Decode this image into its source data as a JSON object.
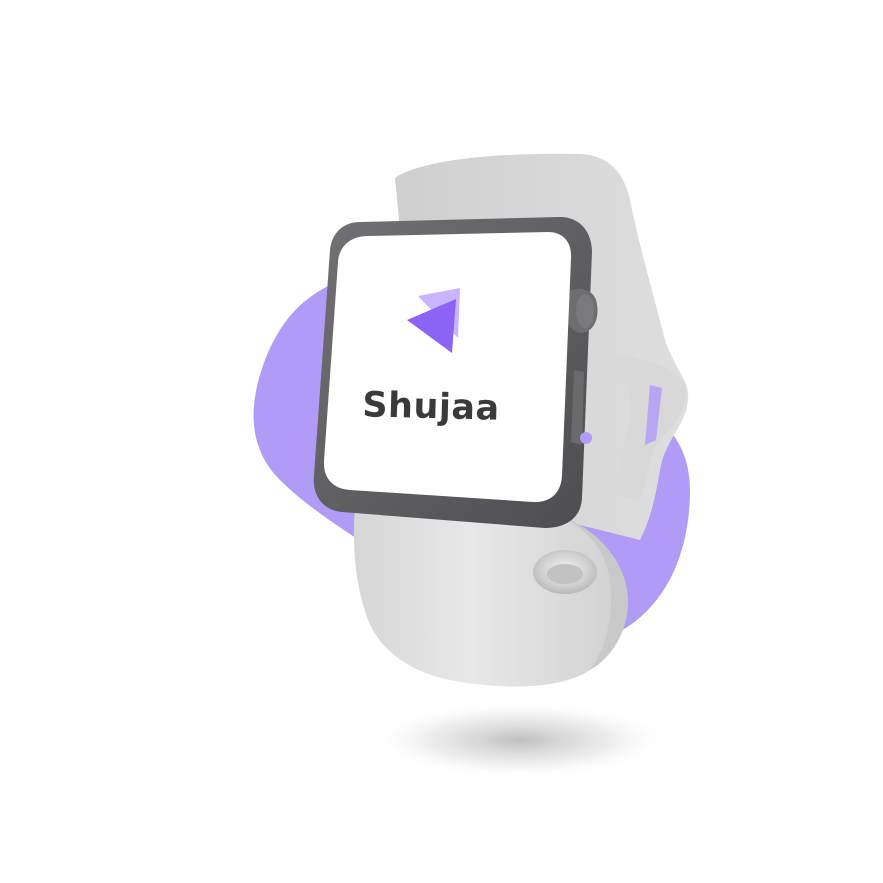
{
  "app": {
    "name": "Shujaa",
    "icon": "play-triangle-icon"
  },
  "colors": {
    "accent": "#8b63f5",
    "accent_light": "#c9b4ff",
    "blob": "#b09cf6",
    "band": "#e3e3e3",
    "case": "#5f5f61",
    "screen": "#ffffff",
    "text": "#3a3a3a"
  }
}
